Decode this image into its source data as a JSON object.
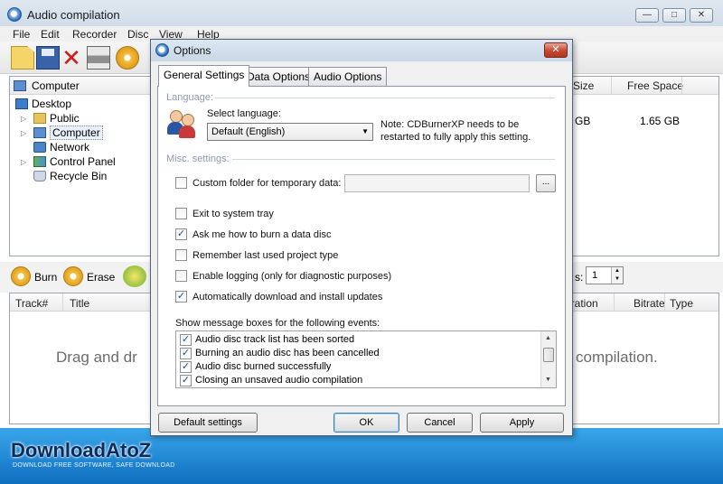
{
  "window": {
    "title": "Audio compilation"
  },
  "menu": [
    "File",
    "Edit",
    "Recorder",
    "Disc",
    "View",
    "Help"
  ],
  "left_tree": {
    "header": "Computer",
    "items": [
      {
        "label": "Desktop",
        "icon": "desktop-icon"
      },
      {
        "label": "Public",
        "icon": "folder-icon"
      },
      {
        "label": "Computer",
        "icon": "computer-icon",
        "selected": true
      },
      {
        "label": "Network",
        "icon": "network-icon"
      },
      {
        "label": "Control Panel",
        "icon": "control-panel-icon"
      },
      {
        "label": "Recycle Bin",
        "icon": "recycle-bin-icon"
      }
    ]
  },
  "drives_table": {
    "columns": [
      "Size",
      "Free Space"
    ],
    "row": {
      "size": "GB",
      "free_space": "1.65 GB"
    }
  },
  "burn_bar": {
    "burn": "Burn",
    "erase": "Erase",
    "copies_label": "s:",
    "copies_value": "1"
  },
  "track_table": {
    "columns": [
      "Track#",
      "Title",
      "uration",
      "Bitrate",
      "Type"
    ]
  },
  "drag_hint": {
    "left": "Drag and dr",
    "right": "compilation."
  },
  "dialog": {
    "title": "Options",
    "close": "✕",
    "tabs": [
      "General Settings",
      "Data Options",
      "Audio Options"
    ],
    "active_tab": 0,
    "language_group": "Language:",
    "select_language_label": "Select language:",
    "language_value": "Default (English)",
    "note_line1": "Note: CDBurnerXP needs to be",
    "note_line2": "restarted to fully apply this setting.",
    "misc_group": "Misc. settings:",
    "custom_folder_label": "Custom folder for temporary data:",
    "custom_folder_checked": false,
    "browse_label": "...",
    "checkboxes": [
      {
        "label": "Exit to system tray",
        "checked": false
      },
      {
        "label": "Ask me how to burn a data disc",
        "checked": true
      },
      {
        "label": "Remember last used project type",
        "checked": false
      },
      {
        "label": "Enable logging (only for diagnostic purposes)",
        "checked": false
      },
      {
        "label": "Automatically download and install updates",
        "checked": true
      }
    ],
    "events_label": "Show message boxes for the following events:",
    "events": [
      {
        "label": "Audio disc track list has been sorted",
        "checked": true
      },
      {
        "label": "Burning an audio disc has been cancelled",
        "checked": true
      },
      {
        "label": "Audio disc burned successfully",
        "checked": true
      },
      {
        "label": "Closing an unsaved audio compilation",
        "checked": true
      }
    ],
    "buttons": {
      "default_settings": "Default settings",
      "ok": "OK",
      "cancel": "Cancel",
      "apply": "Apply"
    }
  },
  "watermark": {
    "text": "DownloadAtoZ",
    "subtext": "DOWNLOAD FREE SOFTWARE, SAFE DOWNLOAD"
  }
}
